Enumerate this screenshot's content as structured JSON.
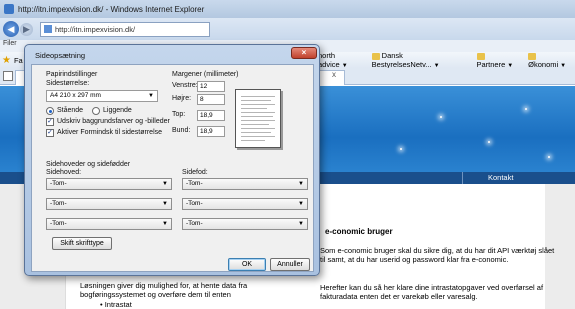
{
  "browser": {
    "window_title": "http://itn.impexvision.dk/ - Windows Internet Explorer",
    "url": "http://itn.impexvision.dk/",
    "menu_fragment": "Filer",
    "favorites_prefix": "Fa",
    "favorites": [
      {
        "label": "north advice"
      },
      {
        "label": "Dansk BestyrelsesNetv..."
      },
      {
        "label": "Partnere"
      },
      {
        "label": "Økonomi"
      }
    ],
    "tab_close": "x"
  },
  "website": {
    "nav_contact": "Kontakt",
    "section_title": "e-conomic bruger",
    "para1": "Som e-conomic bruger skal du sikre dig, at du har dit API værktøj slået til samt, at du har userid og password klar fra e-conomic.",
    "para2": "Herefter kan du så her klare dine intrastatopgaver ved overførsel af fakturadata enten det er varekøb eller varesalg.",
    "left_para": "Løsningen giver dig mulighed for, at hente data fra bogføringssystemet og overføre dem til enten",
    "left_bullet": "• Intrastat"
  },
  "dialog": {
    "title": "Sideopsætning",
    "close": "×",
    "paper_group": "Papirindstillinger",
    "paper_size_label": "Sidestørrelse:",
    "paper_size_value": "A4 210 x 297 mm",
    "orientation_portrait": "Stående",
    "orientation_landscape": "Liggende",
    "portrait_selected": true,
    "print_background_label": "Udskriv baggrundsfarver og -billeder",
    "print_background_checked": true,
    "shrink_to_fit_label": "Aktiver Formindsk til sidestørrelse",
    "shrink_to_fit_checked": true,
    "margins_group": "Margener (millimeter)",
    "margin_left_label": "Venstre:",
    "margin_left_value": "12",
    "margin_right_label": "Højre:",
    "margin_right_value": "8",
    "margin_top_label": "Top:",
    "margin_top_value": "18,9",
    "margin_bottom_label": "Bund:",
    "margin_bottom_value": "18,9",
    "header_footer_group": "Sidehoveder og sidefødder",
    "header_label": "Sidehoved:",
    "footer_label": "Sidefod:",
    "header_values": [
      "-Tom-",
      "-Tom-",
      "-Tom-"
    ],
    "footer_values": [
      "-Tom-",
      "-Tom-",
      "-Tom-"
    ],
    "change_font_button": "Skift skrifttype",
    "ok_button": "OK",
    "cancel_button": "Annuller"
  }
}
